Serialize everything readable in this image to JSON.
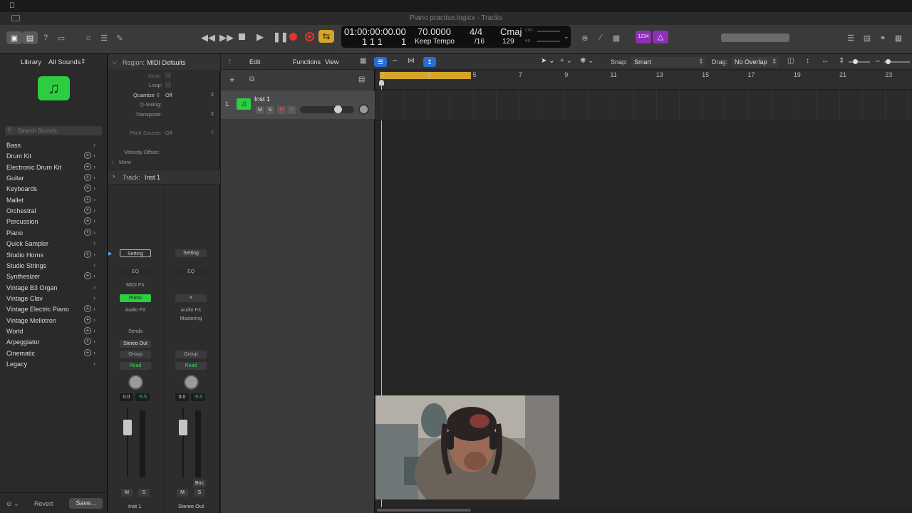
{
  "app": {
    "window_title": "Piano practise.logicx - Tracks"
  },
  "lcd": {
    "timecode": "01:00:00:00.00",
    "bars": "1   1   1",
    "tick": "1",
    "tempo": "70.0000",
    "tempo_mode": "Keep Tempo",
    "signature": "4/4",
    "division": "/16",
    "key": "Cmaj",
    "key_value": "129",
    "cpu_label": "CPU",
    "hd_label": "HD"
  },
  "toolbar": {
    "count_in_label": "1234"
  },
  "library": {
    "title": "Library",
    "filter": "All Sounds",
    "search_placeholder": "Search Sounds",
    "items": [
      {
        "label": "Bass",
        "plus": false
      },
      {
        "label": "Drum Kit",
        "plus": true
      },
      {
        "label": "Electronic Drum Kit",
        "plus": true
      },
      {
        "label": "Guitar",
        "plus": true
      },
      {
        "label": "Keyboards",
        "plus": true
      },
      {
        "label": "Mallet",
        "plus": true
      },
      {
        "label": "Orchestral",
        "plus": true
      },
      {
        "label": "Percussion",
        "plus": true
      },
      {
        "label": "Piano",
        "plus": true
      },
      {
        "label": "Quick Sampler",
        "plus": false
      },
      {
        "label": "Studio Horns",
        "plus": true
      },
      {
        "label": "Studio Strings",
        "plus": false
      },
      {
        "label": "Synthesizer",
        "plus": true
      },
      {
        "label": "Vintage B3 Organ",
        "plus": false
      },
      {
        "label": "Vintage Clav",
        "plus": false
      },
      {
        "label": "Vintage Electric Piano",
        "plus": true
      },
      {
        "label": "Vintage Mellotron",
        "plus": true
      },
      {
        "label": "World",
        "plus": true
      },
      {
        "label": "Arpeggiator",
        "plus": true
      },
      {
        "label": "Cinematic",
        "plus": true
      },
      {
        "label": "Legacy",
        "plus": false
      }
    ],
    "revert_label": "Revert",
    "save_label": "Save..."
  },
  "inspector": {
    "region_prefix": "Region:",
    "region_name": "MIDI Defaults",
    "mute_label": "Mute:",
    "loop_label": "Loop:",
    "quantize_label": "Quantize",
    "quantize_value": "Off",
    "qswing_label": "Q-Swing:",
    "transpose_label": "Transpose:",
    "pitch_source_label": "Pitch Source:",
    "pitch_source_value": "Off",
    "velocity_label": "Velocity Offset:",
    "more_label": "More",
    "track_prefix": "Track:",
    "track_name": "Inst 1"
  },
  "channel1": {
    "setting": "Setting",
    "eq": "EQ",
    "midi_fx": "MIDI FX",
    "instrument": "Piano",
    "audio_fx": "Audio FX",
    "sends": "Sends",
    "output": "Stereo Out",
    "group": "Group",
    "automation": "Read",
    "pan_value": "0.0",
    "level_value": "-5.5",
    "mute": "M",
    "solo": "S",
    "name": "Inst 1"
  },
  "channel2": {
    "setting": "Setting",
    "eq": "EQ",
    "audio_fx": "Audio FX",
    "mastering": "Mastering",
    "group": "Group",
    "automation": "Read",
    "pan_value": "0.0",
    "level_value": "-5.5",
    "bounce": "Bnc",
    "mute": "M",
    "solo": "S",
    "name": "Stereo Out"
  },
  "tracks_header": {
    "edit_label": "Edit",
    "functions_label": "Functions",
    "view_label": "View",
    "snap_label": "Snap:",
    "snap_value": "Smart",
    "drag_label": "Drag:",
    "drag_value": "No Overlap"
  },
  "track": {
    "number": "1",
    "name": "Inst 1",
    "mute": "M",
    "solo": "S",
    "record": "R",
    "input": "I"
  },
  "ruler": [
    "1",
    "3",
    "5",
    "7",
    "9",
    "11",
    "13",
    "15",
    "17",
    "19",
    "21",
    "23"
  ],
  "colors": {
    "accent_green": "#2ecc40",
    "cycle_yellow": "#d4a52a",
    "record_red": "#e0342f",
    "count_in_purple": "#8e2fb8"
  }
}
